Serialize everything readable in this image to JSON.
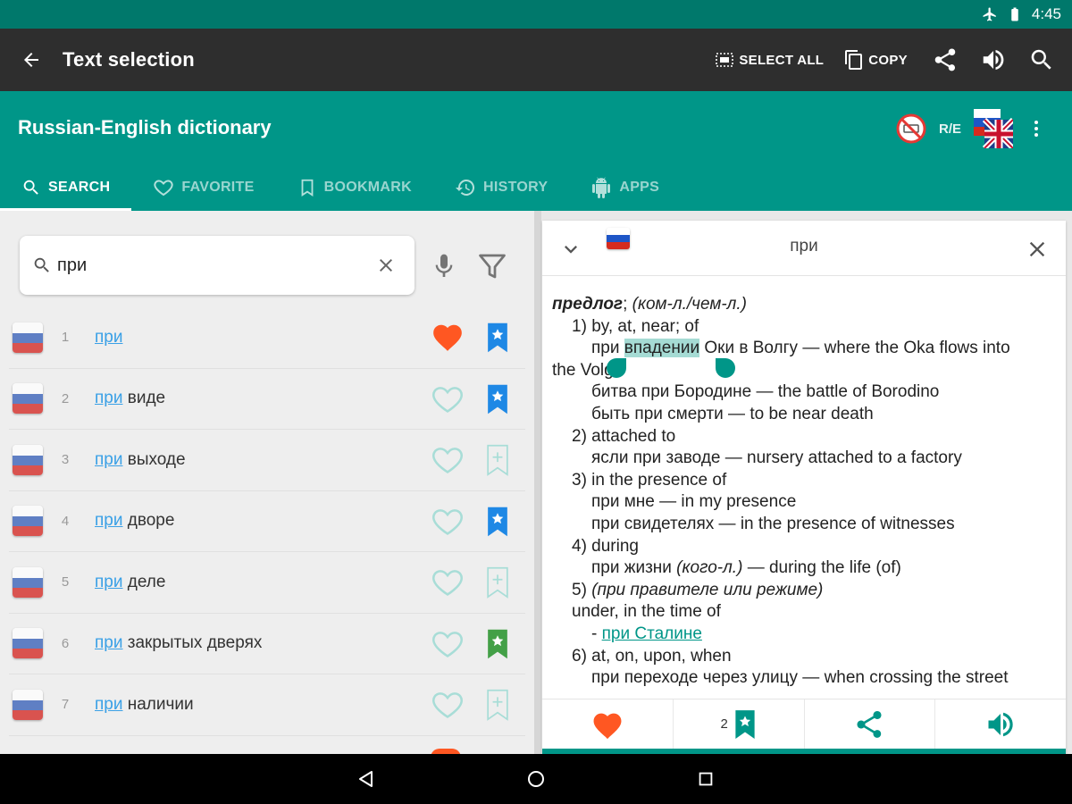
{
  "status_bar": {
    "time": "4:45"
  },
  "action_bar": {
    "title": "Text selection",
    "select_all_label": "SELECT ALL",
    "copy_label": "COPY"
  },
  "app_bar": {
    "title": "Russian-English dictionary",
    "direction": "R/E",
    "tabs": [
      {
        "label": "SEARCH",
        "icon": "search-icon",
        "active": true
      },
      {
        "label": "FAVORITE",
        "icon": "heart-icon"
      },
      {
        "label": "BOOKMARK",
        "icon": "bookmark-icon"
      },
      {
        "label": "HISTORY",
        "icon": "history-icon"
      },
      {
        "label": "APPS",
        "icon": "android-icon"
      }
    ]
  },
  "search": {
    "value": "при"
  },
  "results": [
    {
      "num": "1",
      "prefix": "при",
      "rest": "",
      "favorite": true,
      "bookmark": "filled-blue"
    },
    {
      "num": "2",
      "prefix": "при",
      "rest": " виде",
      "favorite": false,
      "bookmark": "filled-blue"
    },
    {
      "num": "3",
      "prefix": "при",
      "rest": " выходе",
      "favorite": false,
      "bookmark": "outline"
    },
    {
      "num": "4",
      "prefix": "при",
      "rest": " дворе",
      "favorite": false,
      "bookmark": "filled-blue"
    },
    {
      "num": "5",
      "prefix": "при",
      "rest": " деле",
      "favorite": false,
      "bookmark": "outline"
    },
    {
      "num": "6",
      "prefix": "при",
      "rest": " закрытых дверях",
      "favorite": false,
      "bookmark": "filled-green"
    },
    {
      "num": "7",
      "prefix": "при",
      "rest": " наличии",
      "favorite": false,
      "bookmark": "outline"
    }
  ],
  "card": {
    "word": "при",
    "pos": "предлог",
    "pos_note": "(ком-л./чем-л.)",
    "s1_num": "1)",
    "s1_text": "by, at, near; of",
    "s1_ex1_a": "при ",
    "s1_ex1_sel": "впадении",
    "s1_ex1_b": " Оки в Волгу — where the Oka flows into",
    "s1_ex1_c": "the Volga",
    "s1_ex2": "битва при Бородине — the battle of Borodino",
    "s1_ex3": "быть при смерти — to be near death",
    "s2": "2) attached to",
    "s2_ex1": "ясли при заводе — nursery attached to a factory",
    "s3": "3) in the presence of",
    "s3_ex1": "при мне — in my presence",
    "s3_ex2": "при свидетелях — in the presence of witnesses",
    "s4": "4) during",
    "s4_ex1_a": "при жизни ",
    "s4_ex1_it": "(кого-л.)",
    "s4_ex1_b": " — during the life (of)",
    "s5_num": "5)",
    "s5_note": "(при правителе или режиме)",
    "s5_text": "under, in the time of",
    "s5_link_dash": "- ",
    "s5_link": "при Сталине",
    "s6": "6) at, on, upon, when",
    "s6_ex1": "при переходе через улицу — when crossing the street",
    "bookmark_count": "2"
  },
  "colors": {
    "teal": "#009688",
    "teal_dark": "#00786b",
    "action_bar": "#2e2e2e",
    "favorite": "#ff5722",
    "bookmark_blue": "#1e88e5",
    "bookmark_green": "#43a047"
  }
}
